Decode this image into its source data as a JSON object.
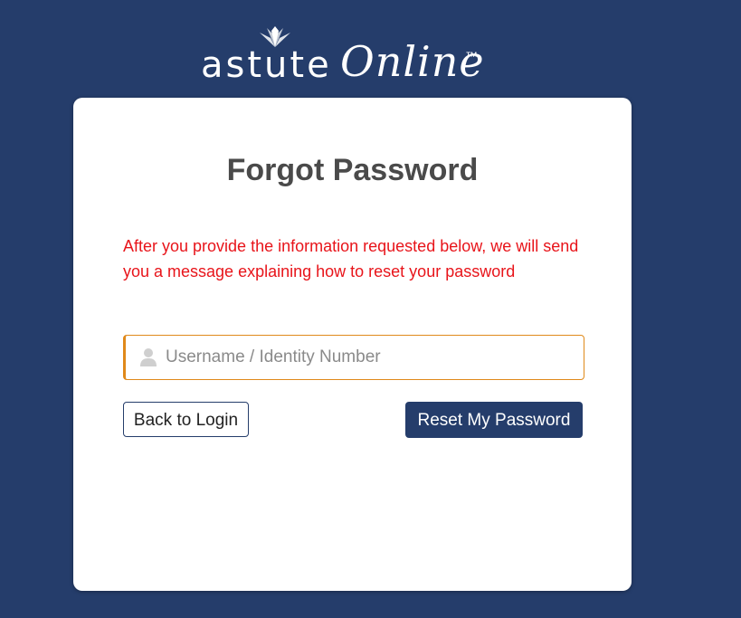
{
  "brand": {
    "word": "astute",
    "script": "Online",
    "tm": "™"
  },
  "form": {
    "title": "Forgot Password",
    "info": "After you provide the information requested below, we will send you a message explaining how to reset your password",
    "username_placeholder": "Username / Identity Number",
    "username_value": "",
    "back_label": "Back to Login",
    "reset_label": "Reset My Password"
  },
  "icons": {
    "logo_mark": "leaf-mark-icon",
    "user": "user-icon"
  },
  "colors": {
    "background": "#253d6b",
    "card": "#ffffff",
    "title": "#4a4a4a",
    "info": "#e8141a",
    "input_border": "#e0891a",
    "primary_button": "#253d6b"
  }
}
